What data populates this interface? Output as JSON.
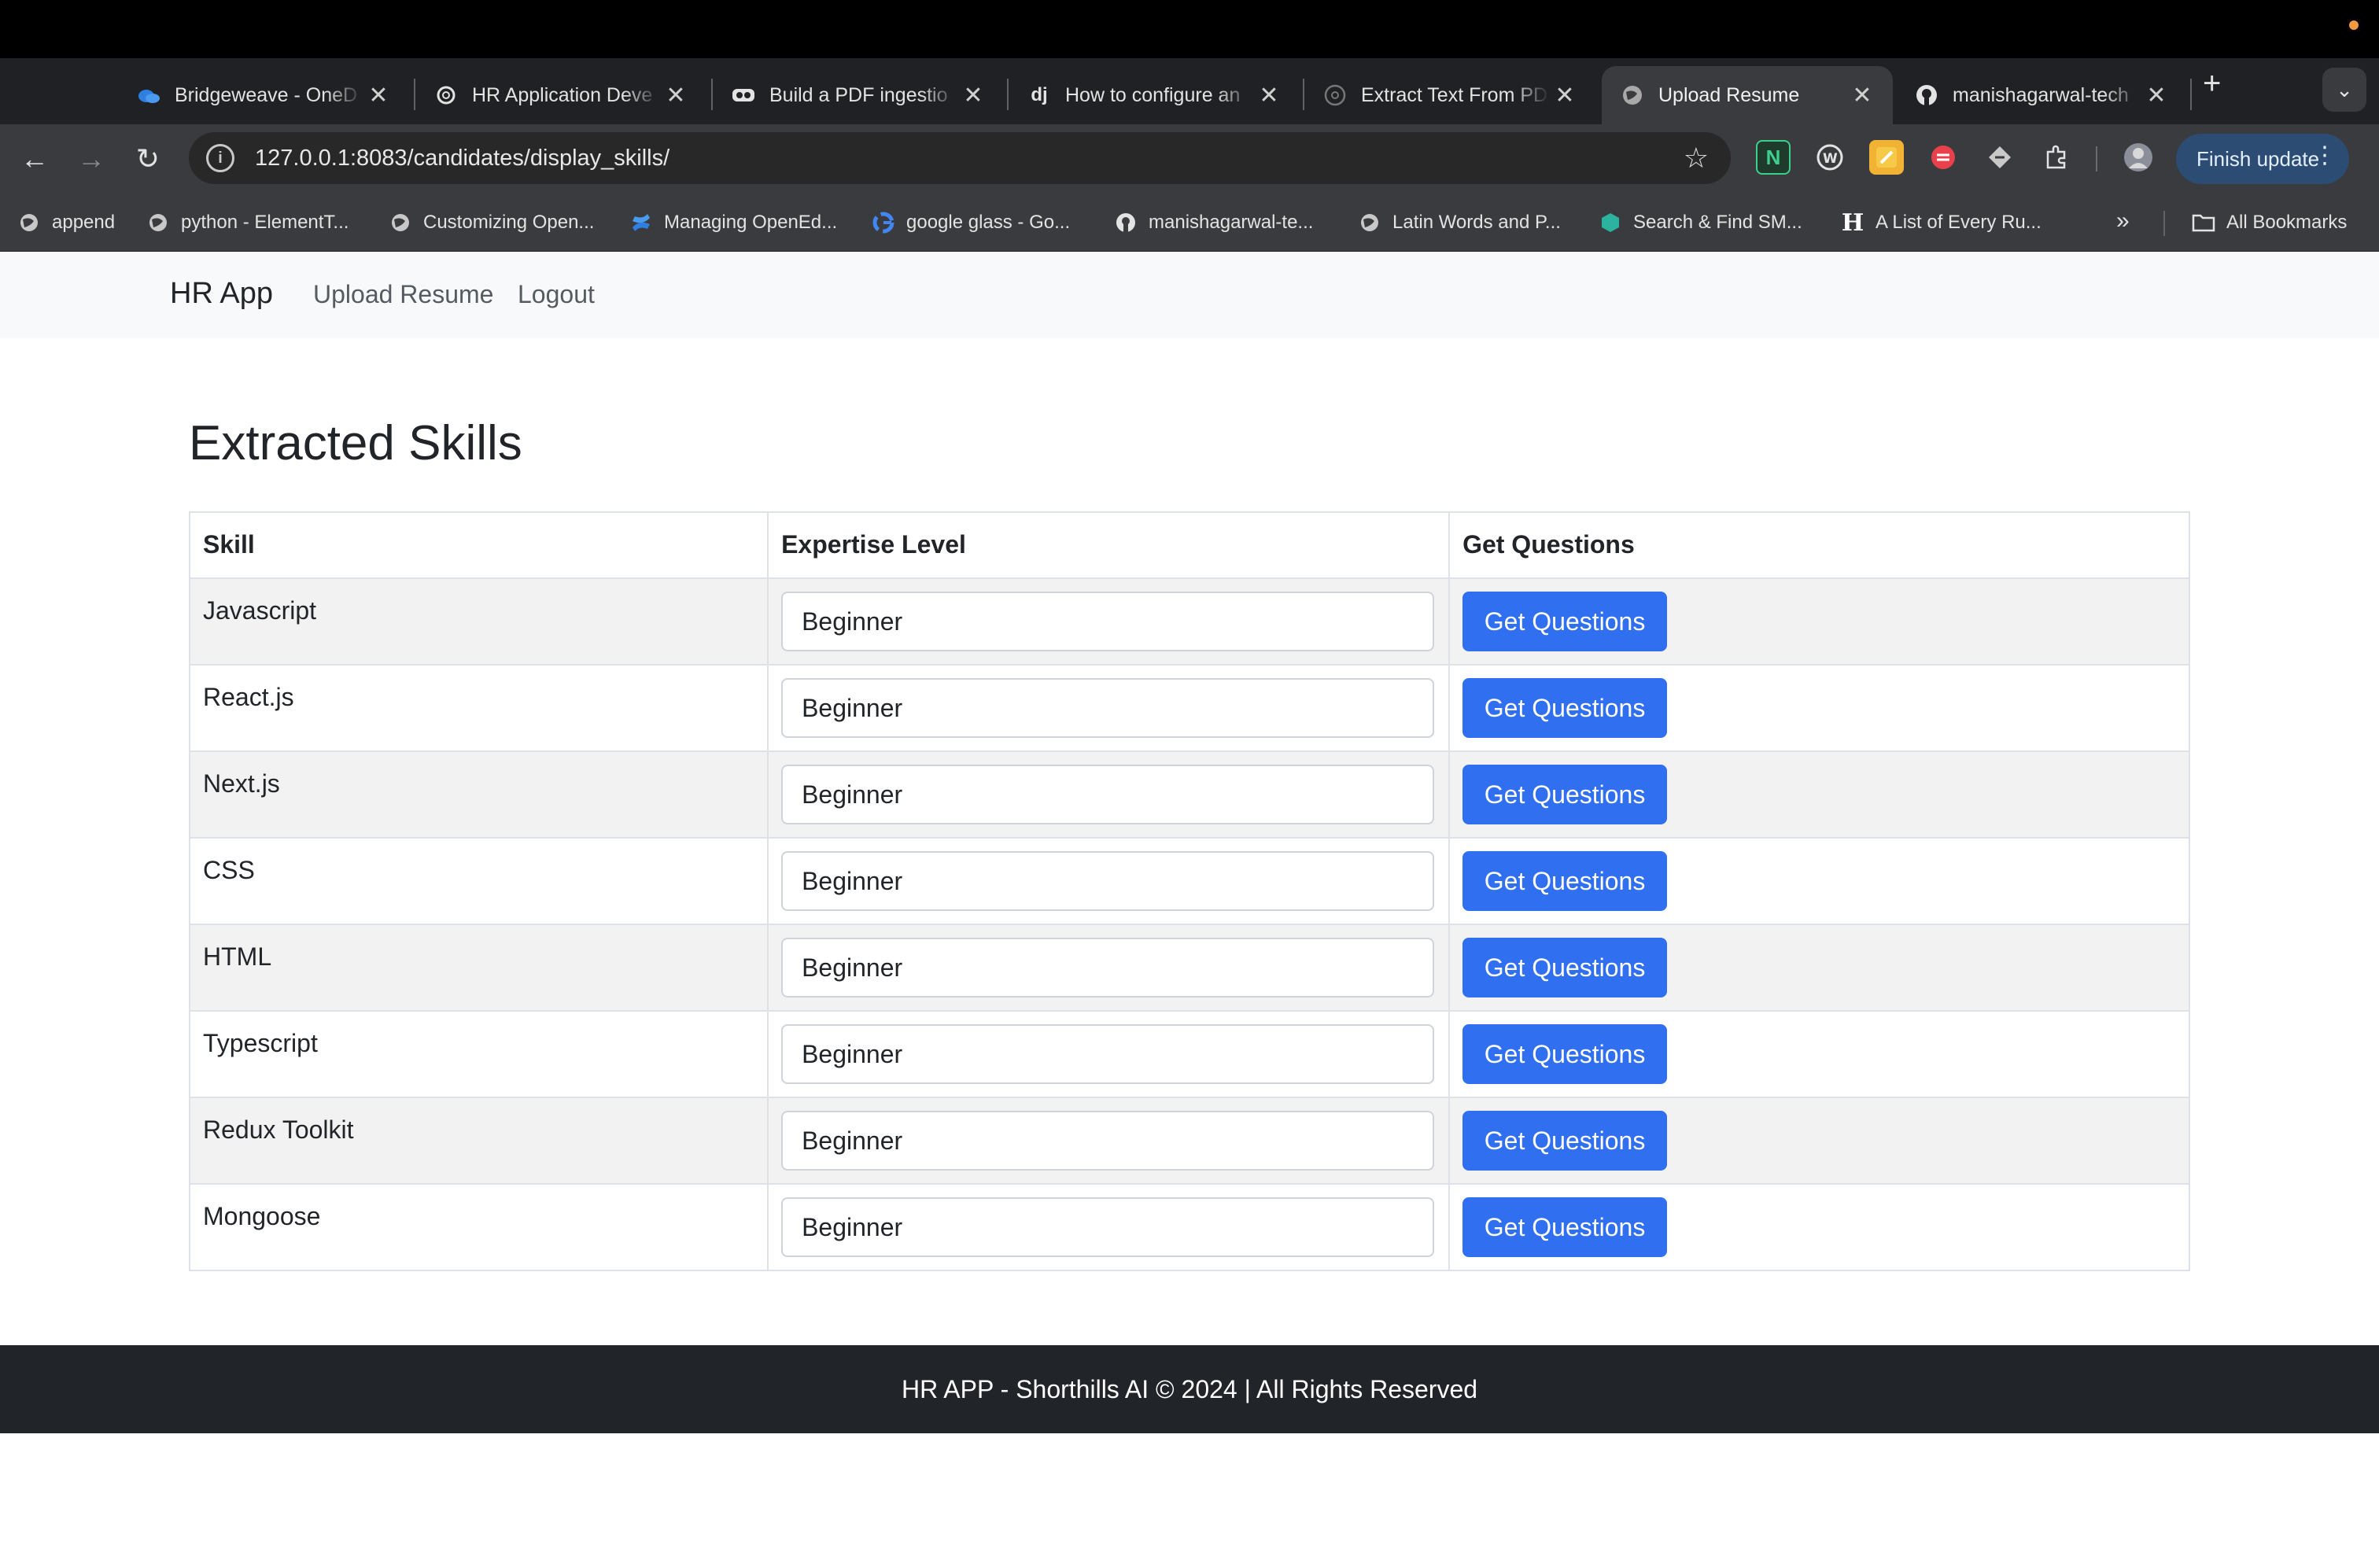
{
  "browser": {
    "tabs": [
      {
        "title": "Bridgeweave - OneD",
        "icon": "onedrive-icon",
        "active": false
      },
      {
        "title": "HR Application Deve",
        "icon": "openai-icon",
        "active": false
      },
      {
        "title": "Build a PDF ingestio",
        "icon": "pdf-tool-icon",
        "active": false
      },
      {
        "title": "How to configure an",
        "icon": "django-icon",
        "active": false
      },
      {
        "title": "Extract Text From PD",
        "icon": "globe-icon",
        "active": false
      },
      {
        "title": "Upload Resume",
        "icon": "globe-icon",
        "active": true
      },
      {
        "title": "manishagarwal-tech",
        "icon": "github-icon",
        "active": false
      }
    ],
    "url": "127.0.0.1:8083/candidates/display_skills/",
    "update_label": "Finish update",
    "bookmarks": [
      {
        "label": "append",
        "icon": "globe-icon"
      },
      {
        "label": "python - ElementT...",
        "icon": "globe-icon"
      },
      {
        "label": "Customizing Open...",
        "icon": "globe-icon"
      },
      {
        "label": "Managing OpenEd...",
        "icon": "confluence-icon"
      },
      {
        "label": "google glass - Go...",
        "icon": "google-icon"
      },
      {
        "label": "manishagarwal-te...",
        "icon": "github-icon"
      },
      {
        "label": "Latin Words and P...",
        "icon": "globe-icon"
      },
      {
        "label": "Search & Find SM...",
        "icon": "hexagon-icon"
      },
      {
        "label": "A List of Every Ru...",
        "icon": "h-logo-icon"
      }
    ],
    "all_bookmarks_label": "All Bookmarks"
  },
  "nav": {
    "brand": "HR App",
    "links": [
      "Upload Resume",
      "Logout"
    ]
  },
  "page": {
    "title": "Extracted Skills"
  },
  "table": {
    "headers": [
      "Skill",
      "Expertise Level",
      "Get Questions"
    ],
    "button_label": "Get Questions",
    "rows": [
      {
        "skill": "Javascript",
        "level": "Beginner"
      },
      {
        "skill": "React.js",
        "level": "Beginner"
      },
      {
        "skill": "Next.js",
        "level": "Beginner"
      },
      {
        "skill": "CSS",
        "level": "Beginner"
      },
      {
        "skill": "HTML",
        "level": "Beginner"
      },
      {
        "skill": "Typescript",
        "level": "Beginner"
      },
      {
        "skill": "Redux Toolkit",
        "level": "Beginner"
      },
      {
        "skill": "Mongoose",
        "level": "Beginner"
      }
    ]
  },
  "footer": {
    "text": "HR APP - Shorthills AI © 2024 | All Rights Reserved"
  },
  "colors": {
    "primary_button": "#2f6ff0",
    "footer_bg": "#212529",
    "navbar_bg": "#f8f9fa"
  }
}
